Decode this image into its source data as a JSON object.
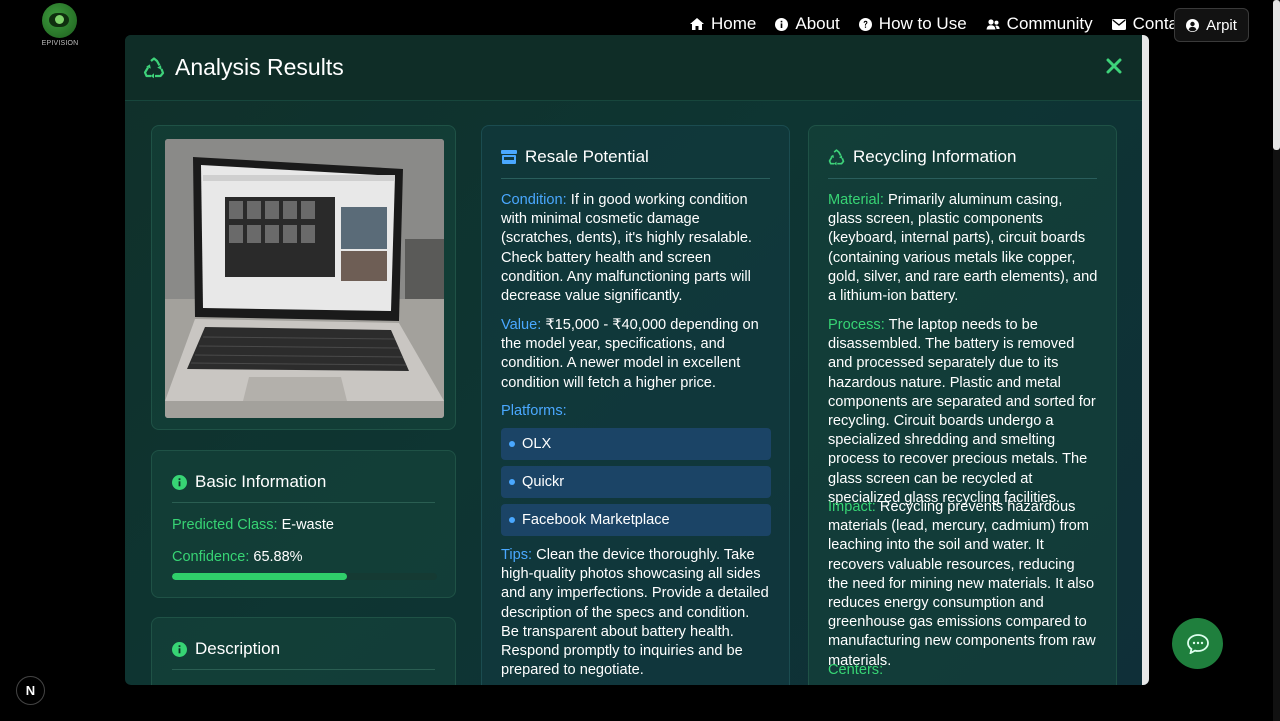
{
  "logo": {
    "text": "EPIVISION"
  },
  "nav": {
    "items": [
      {
        "label": "Home",
        "icon": "home-icon"
      },
      {
        "label": "About",
        "icon": "info-icon"
      },
      {
        "label": "How to Use",
        "icon": "question-icon"
      },
      {
        "label": "Community",
        "icon": "users-icon"
      },
      {
        "label": "Contact",
        "icon": "envelope-icon"
      }
    ],
    "user": {
      "label": "Arpit",
      "icon": "user-circle-icon"
    }
  },
  "modal": {
    "title": "Analysis Results",
    "title_icon": "recycle-icon",
    "basic_info": {
      "title": "Basic Information",
      "predicted_class_label": "Predicted Class:",
      "predicted_class_value": "E-waste",
      "confidence_label": "Confidence:",
      "confidence_value": "65.88%",
      "confidence_fraction": 0.6588
    },
    "description": {
      "title": "Description"
    },
    "resale": {
      "title": "Resale Potential",
      "condition_label": "Condition:",
      "condition_text": "If in good working condition with minimal cosmetic damage (scratches, dents), it's highly resalable. Check battery health and screen condition. Any malfunctioning parts will decrease value significantly.",
      "value_label": "Value:",
      "value_text": "₹15,000 - ₹40,000 depending on the model year, specifications, and condition. A newer model in excellent condition will fetch a higher price.",
      "platforms_label": "Platforms:",
      "platforms": [
        "OLX",
        "Quickr",
        "Facebook Marketplace"
      ],
      "tips_label": "Tips:",
      "tips_text": "Clean the device thoroughly. Take high-quality photos showcasing all sides and any imperfections. Provide a detailed description of the specs and condition. Be transparent about battery health. Respond promptly to inquiries and be prepared to negotiate."
    },
    "recycling": {
      "title": "Recycling Information",
      "material_label": "Material:",
      "material_text": "Primarily aluminum casing, glass screen, plastic components (keyboard, internal parts), circuit boards (containing various metals like copper, gold, silver, and rare earth elements), and a lithium-ion battery.",
      "process_label": "Process:",
      "process_text": "The laptop needs to be disassembled. The battery is removed and processed separately due to its hazardous nature. Plastic and metal components are separated and sorted for recycling. Circuit boards undergo a specialized shredding and smelting process to recover precious metals. The glass screen can be recycled at specialized glass recycling facilities.",
      "impact_label": "Impact:",
      "impact_text": "Recycling prevents hazardous materials (lead, mercury, cadmium) from leaching into the soil and water. It recovers valuable resources, reducing the need for mining new materials. It also reduces energy consumption and greenhouse gas emissions compared to manufacturing new components from raw materials.",
      "centers_label": "Centers:"
    }
  },
  "colors": {
    "accent_green": "#37d474",
    "accent_blue": "#4aa8ff",
    "modal_bg": "#0f2d27"
  },
  "badge": {
    "label": "N"
  }
}
